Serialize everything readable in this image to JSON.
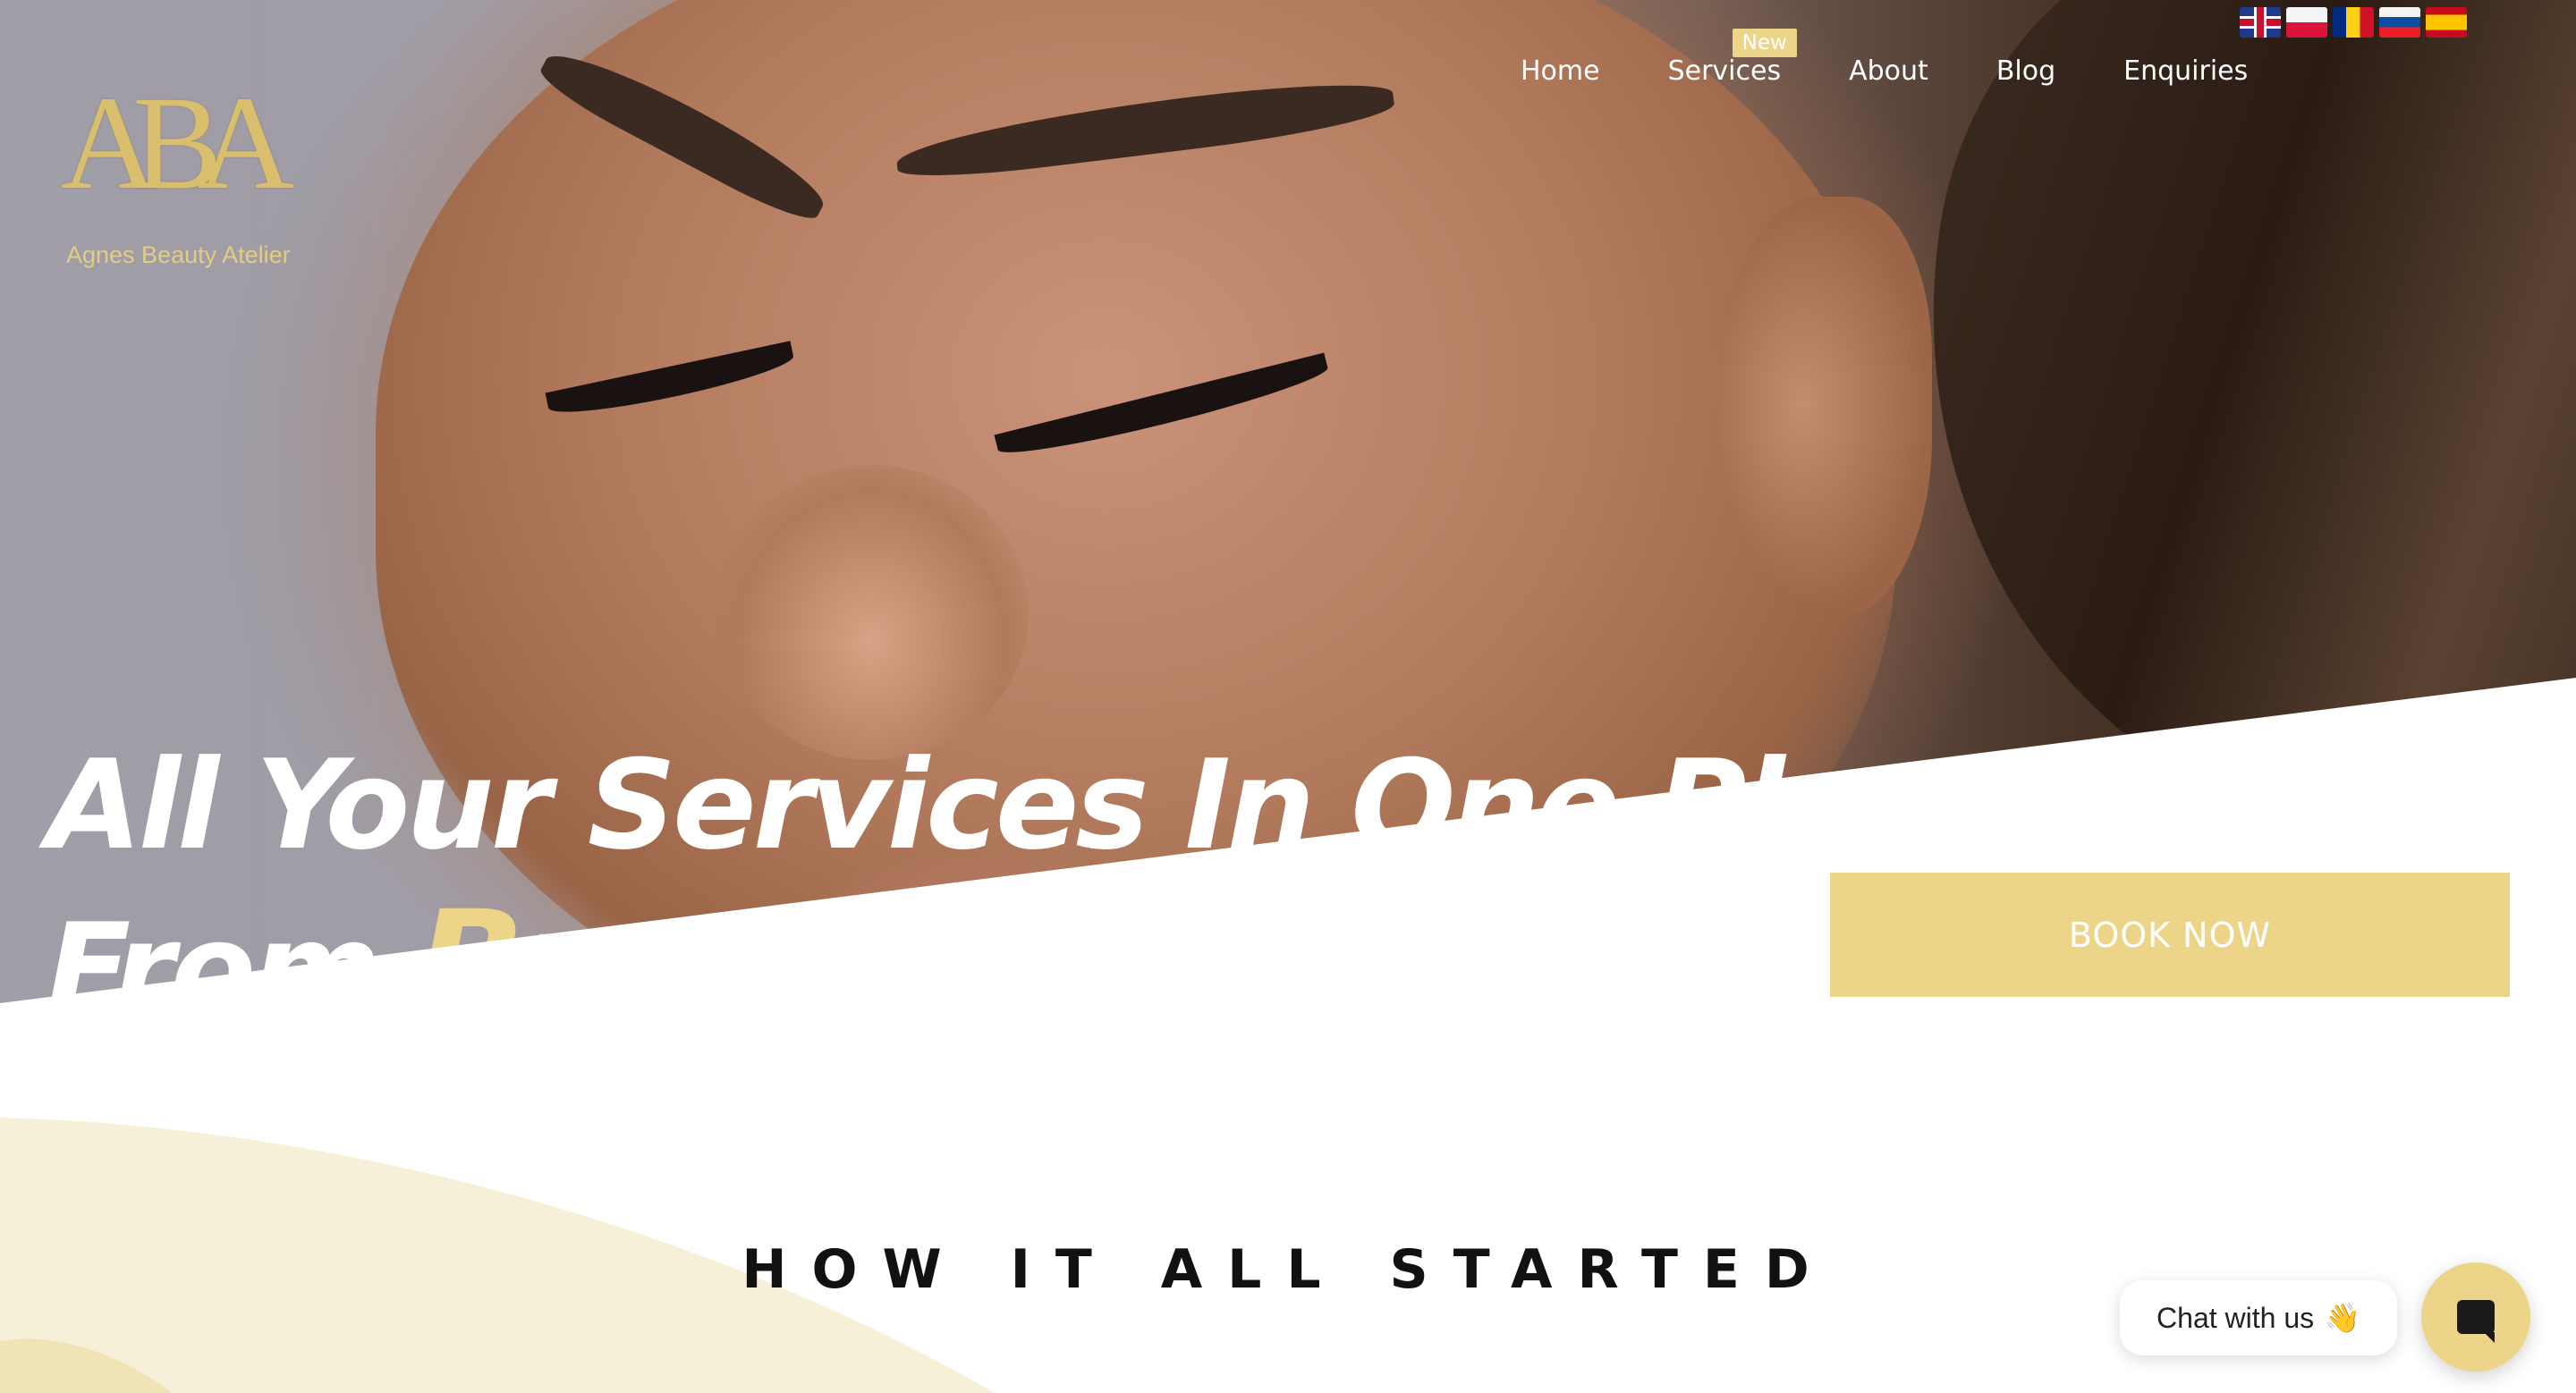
{
  "brand": {
    "logo_mark": "ABA",
    "logo_name": "Agnes Beauty Atelier"
  },
  "nav": {
    "items": [
      {
        "label": "Home"
      },
      {
        "label": "Services",
        "badge": "New"
      },
      {
        "label": "About"
      },
      {
        "label": "Blog"
      },
      {
        "label": "Enquiries"
      }
    ]
  },
  "languages": [
    {
      "flag": "uk-flag-icon"
    },
    {
      "flag": "poland-flag-icon"
    },
    {
      "flag": "romania-flag-icon"
    },
    {
      "flag": "slovakia-flag-icon"
    },
    {
      "flag": "spain-flag-icon"
    }
  ],
  "hero": {
    "line1": "All Your Services In One Place",
    "line2_prefix": "From ",
    "line2_accent": "Brow Treatmen",
    "cta": "BOOK NOW"
  },
  "section": {
    "title": "HOW IT ALL STARTED"
  },
  "chat": {
    "label": "Chat with us",
    "emoji": "👋"
  },
  "colors": {
    "accent": "#ecd588",
    "wave": "#f7f0d8",
    "text_dark": "#111111"
  }
}
